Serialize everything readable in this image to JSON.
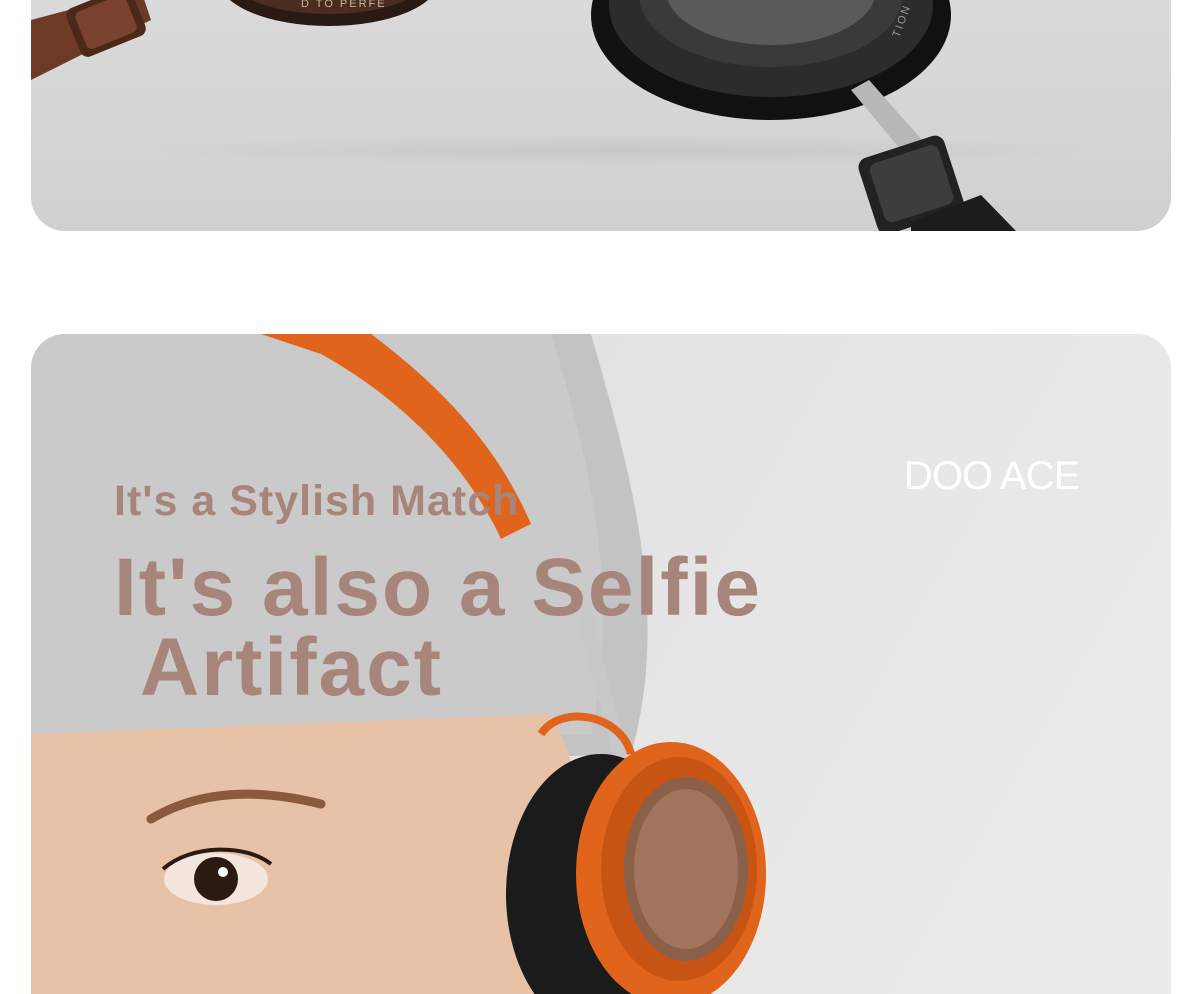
{
  "top_image": {
    "alt_icons": [
      "headphone-brown-earcup",
      "headphone-black-earcup"
    ],
    "earcup_text_left": "D TO PERFE",
    "earcup_text_right": "TION"
  },
  "lifestyle": {
    "headline_small": "It's a Stylish Match",
    "headline_big_line1": "It's also a Selfie",
    "headline_big_line2": "Artifact",
    "brand": "DOO ACE"
  },
  "colors": {
    "headline": "#a8857a",
    "accent_orange": "#e0641c",
    "brand_logo": "#ffffff"
  }
}
